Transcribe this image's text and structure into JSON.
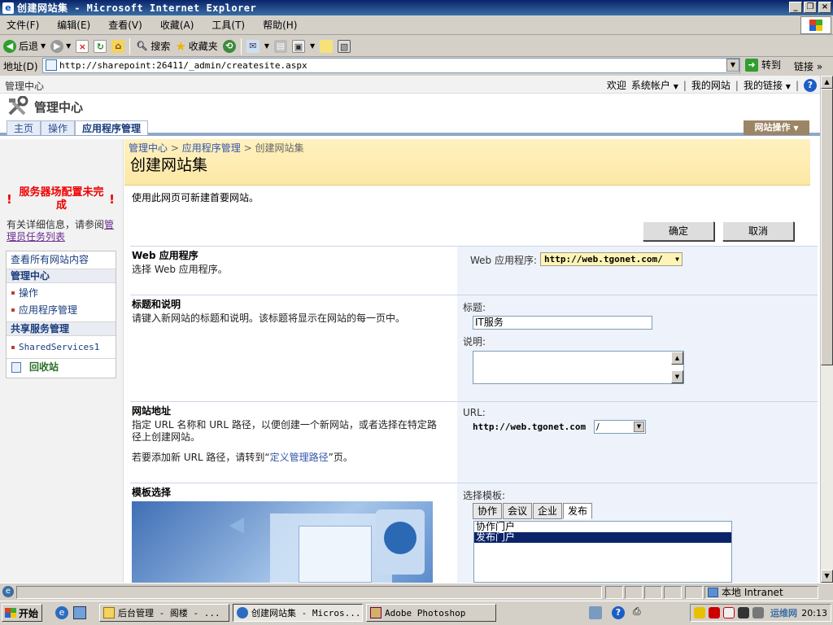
{
  "window": {
    "title": "创建网站集 - Microsoft Internet Explorer"
  },
  "menu": [
    "文件(F)",
    "编辑(E)",
    "查看(V)",
    "收藏(A)",
    "工具(T)",
    "帮助(H)"
  ],
  "toolbar": {
    "back": "后退",
    "search": "搜索",
    "favorites": "收藏夹"
  },
  "address": {
    "label": "地址(D)",
    "url": "http://sharepoint:26411/_admin/createsite.aspx",
    "go": "转到",
    "links": "链接"
  },
  "sp": {
    "top_title": "管理中心",
    "welcome": "欢迎",
    "account": "系统帐户",
    "my_site": "我的网站",
    "my_links": "我的链接",
    "site_title": "管理中心",
    "tabs": [
      "主页",
      "操作",
      "应用程序管理"
    ],
    "site_actions": "网站操作",
    "warning": "服务器场配置未完成",
    "warning_info_prefix": "有关详细信息，请参阅",
    "warning_link": "管理员任务列表",
    "nav": {
      "view_all": "查看所有网站内容",
      "head1": "管理中心",
      "item1": "操作",
      "item2": "应用程序管理",
      "head2": "共享服务管理",
      "item3": "SharedServices1",
      "recycle": "回收站"
    },
    "breadcrumb": [
      "管理中心",
      "应用程序管理",
      "创建网站集"
    ],
    "page_title": "创建网站集",
    "page_desc": "使用此网页可新建首要网站。",
    "ok": "确定",
    "cancel": "取消",
    "sections": {
      "webapp": {
        "title": "Web 应用程序",
        "desc": "选择 Web 应用程序。",
        "label": "Web 应用程序:",
        "value": "http://web.tgonet.com/"
      },
      "title_desc": {
        "title": "标题和说明",
        "desc": "请键入新网站的标题和说明。该标题将显示在网站的每一页中。",
        "title_label": "标题:",
        "title_value": "IT服务",
        "desc_label": "说明:"
      },
      "address": {
        "title": "网站地址",
        "desc": "指定 URL 名称和 URL 路径，以便创建一个新网站，或者选择在特定路径上创建网站。",
        "add_prefix": "若要添加新 URL 路径，请转到“",
        "add_link": "定义管理路径",
        "add_suffix": "”页。",
        "url_label": "URL:",
        "url_prefix": "http://web.tgonet.com",
        "path_value": "/"
      },
      "template": {
        "title": "模板选择",
        "label": "选择模板:",
        "tabs": [
          "协作",
          "会议",
          "企业",
          "发布"
        ],
        "items": [
          "协作门户",
          "发布门户"
        ]
      }
    }
  },
  "status": {
    "zone": "本地 Intranet"
  },
  "taskbar": {
    "start": "开始",
    "tasks": [
      "后台管理 - 阁楼 - ...",
      "创建网站集 - Micros...",
      "Adobe Photoshop"
    ],
    "time": "20:13",
    "watermark": "运维网"
  }
}
